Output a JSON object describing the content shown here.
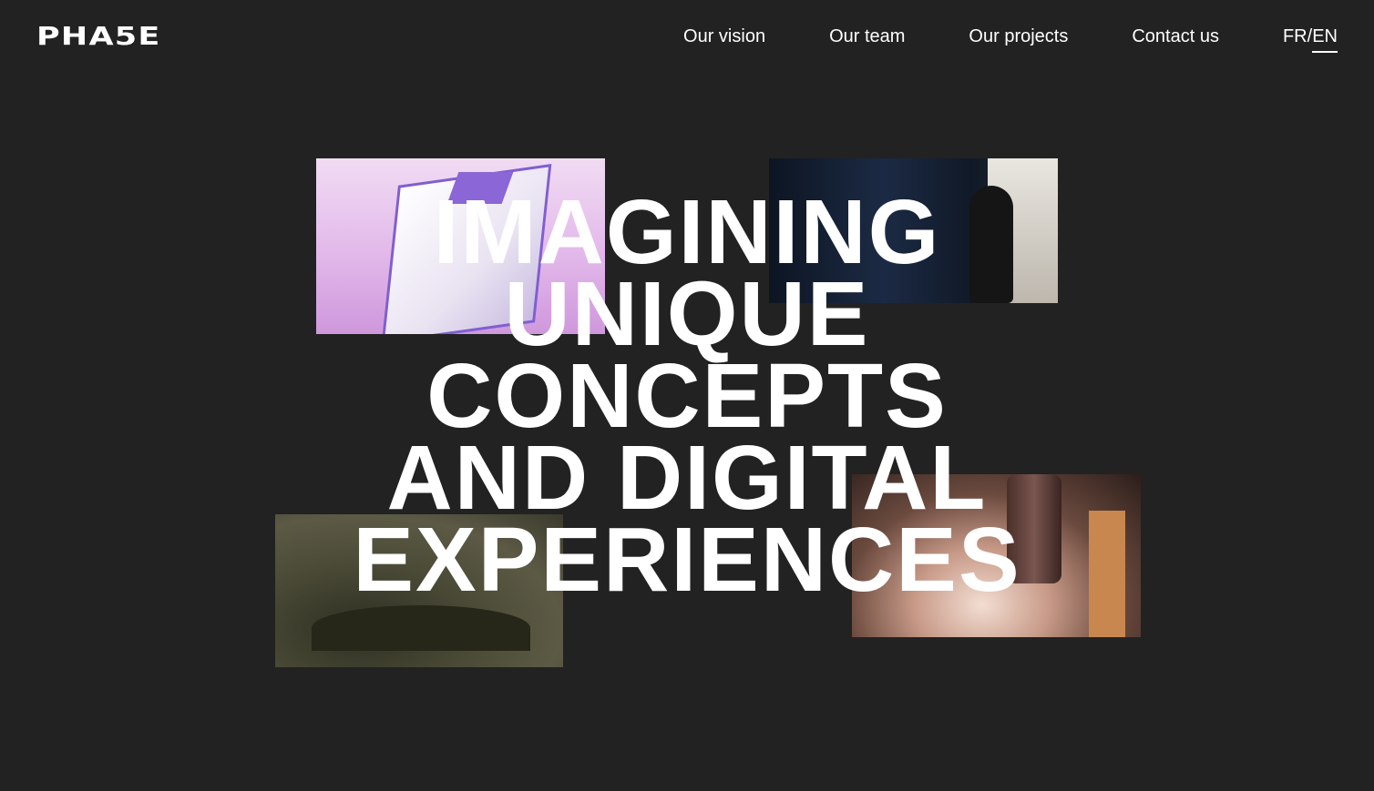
{
  "header": {
    "logo": "PHA5E",
    "nav": [
      {
        "label": "Our vision"
      },
      {
        "label": "Our team"
      },
      {
        "label": "Our projects"
      },
      {
        "label": "Contact us"
      }
    ],
    "language": {
      "fr": "FR",
      "separator": "/",
      "en": "EN",
      "active": "EN"
    }
  },
  "hero": {
    "lines": [
      "IMAGINING",
      "UNIQUE",
      "CONCEPTS",
      "AND DIGITAL",
      "EXPERIENCES"
    ]
  },
  "colors": {
    "background": "#222222",
    "text": "#ffffff"
  }
}
